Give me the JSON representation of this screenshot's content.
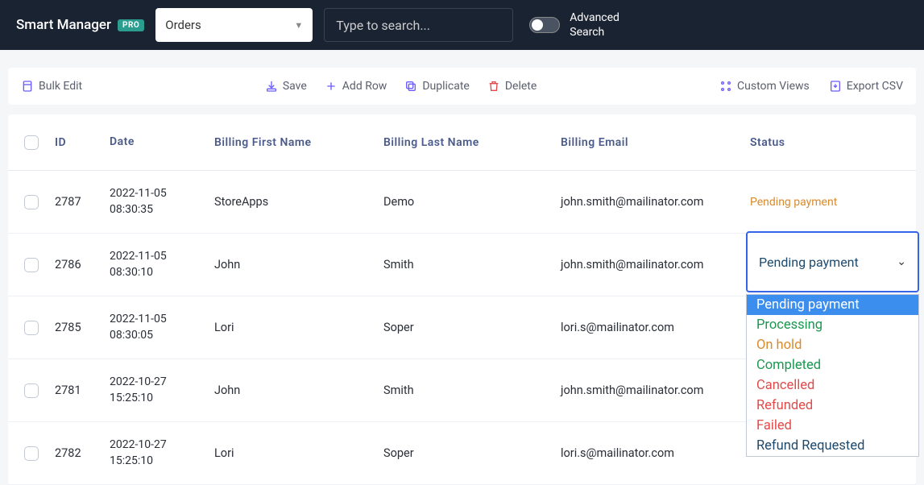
{
  "header": {
    "brand": "Smart Manager",
    "badge": "PRO",
    "selector_value": "Orders",
    "search_placeholder": "Type to search...",
    "adv1": "Advanced",
    "adv2": "Search"
  },
  "toolbar": {
    "bulk_edit": "Bulk Edit",
    "save": "Save",
    "add_row": "Add Row",
    "duplicate": "Duplicate",
    "delete": "Delete",
    "custom_views": "Custom Views",
    "export_csv": "Export CSV"
  },
  "columns": {
    "id": "ID",
    "date": "Date",
    "first": "Billing First Name",
    "last": "Billing Last Name",
    "email": "Billing Email",
    "status": "Status"
  },
  "rows": [
    {
      "id": "2787",
      "d1": "2022-11-05",
      "d2": "08:30:35",
      "first": "StoreApps",
      "last": "Demo",
      "email": "john.smith@mailinator.com",
      "status": "Pending payment"
    },
    {
      "id": "2786",
      "d1": "2022-11-05",
      "d2": "08:30:10",
      "first": "John",
      "last": "Smith",
      "email": "john.smith@mailinator.com",
      "status": ""
    },
    {
      "id": "2785",
      "d1": "2022-11-05",
      "d2": "08:30:05",
      "first": "Lori",
      "last": "Soper",
      "email": "lori.s@mailinator.com",
      "status": ""
    },
    {
      "id": "2781",
      "d1": "2022-10-27",
      "d2": "15:25:10",
      "first": "John",
      "last": "Smith",
      "email": "john.smith@mailinator.com",
      "status": ""
    },
    {
      "id": "2782",
      "d1": "2022-10-27",
      "d2": "15:25:10",
      "first": "Lori",
      "last": "Soper",
      "email": "lori.s@mailinator.com",
      "status": ""
    }
  ],
  "status_dropdown": {
    "selected": "Pending payment",
    "options": [
      {
        "label": "Pending payment",
        "cls": "sel"
      },
      {
        "label": "Processing",
        "cls": "green"
      },
      {
        "label": "On hold",
        "cls": "orange"
      },
      {
        "label": "Completed",
        "cls": "green"
      },
      {
        "label": "Cancelled",
        "cls": "red"
      },
      {
        "label": "Refunded",
        "cls": "red"
      },
      {
        "label": "Failed",
        "cls": "red"
      },
      {
        "label": "Refund Requested",
        "cls": "blue"
      }
    ]
  }
}
